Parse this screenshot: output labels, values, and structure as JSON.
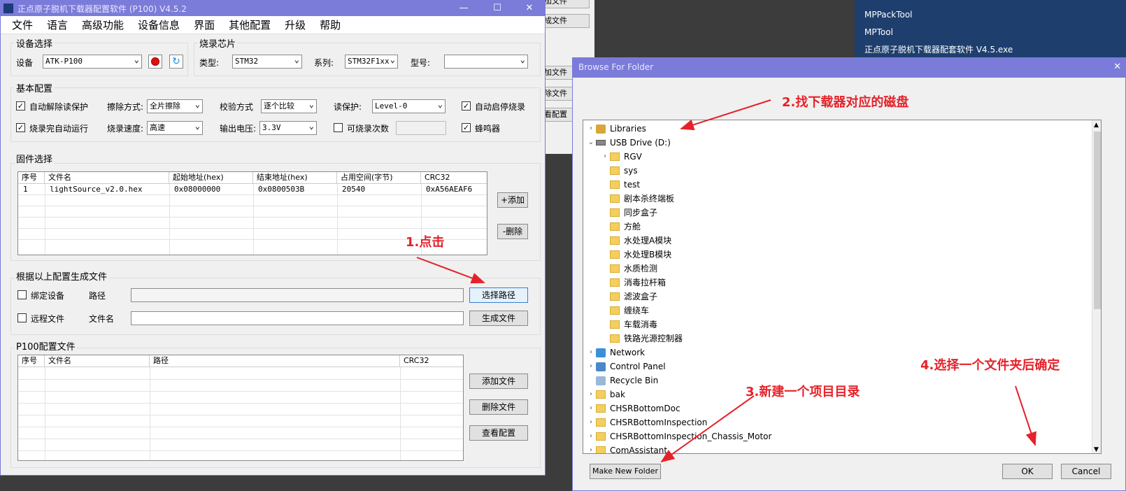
{
  "desktop": {
    "items": [
      {
        "label": "MPPackTool",
        "color": "#d89a2b"
      },
      {
        "label": "MPTool",
        "color": "#3a6fc4"
      },
      {
        "label": "正点原子脱机下载器配套软件 V4.5.exe",
        "color": "#2a4e8c"
      }
    ]
  },
  "behind_window": {
    "buttons": [
      "加文件",
      "成文件",
      "加文件",
      "除文件",
      "看配置"
    ]
  },
  "main_window": {
    "title": "正点原子脱机下载器配置软件 (P100)  V4.5.2",
    "controls": {
      "minimize": "—",
      "maximize": "☐",
      "close": "✕"
    },
    "menu": [
      "文件",
      "语言",
      "高级功能",
      "设备信息",
      "界面",
      "其他配置",
      "升级",
      "帮助"
    ],
    "device_group": {
      "title": "设备选择",
      "device_label": "设备",
      "device_value": "ATK-P100"
    },
    "chip_group": {
      "title": "烧录芯片",
      "type_label": "类型:",
      "type_value": "STM32",
      "series_label": "系列:",
      "series_value": "STM32F1xx",
      "model_label": "型号:",
      "model_value": ""
    },
    "basic_group": {
      "title": "基本配置",
      "auto_unprotect": "自动解除读保护",
      "erase_label": "擦除方式:",
      "erase_value": "全片擦除",
      "verify_label": "校验方式",
      "verify_value": "逐个比较",
      "readprot_label": "读保护:",
      "readprot_value": "Level-0",
      "auto_start": "自动启停烧录",
      "auto_run": "烧录完自动运行",
      "speed_label": "烧录速度:",
      "speed_value": "高速",
      "voltage_label": "输出电压:",
      "voltage_value": "3.3V",
      "count_label": "可烧录次数",
      "buzzer": "蜂鸣器"
    },
    "firmware_group": {
      "title": "固件选择",
      "headers": [
        "序号",
        "文件名",
        "起始地址(hex)",
        "结束地址(hex)",
        "占用空间(字节)",
        "CRC32"
      ],
      "rows": [
        [
          "1",
          "lightSource_v2.0.hex",
          "0x08000000",
          "0x0800503B",
          "20540",
          "0xA56AEAF6"
        ]
      ],
      "add_button": "+添加",
      "delete_button": "-删除"
    },
    "generate_group": {
      "title": "根据以上配置生成文件",
      "bind_device": "绑定设备",
      "path_label": "路径",
      "select_path_button": "选择路径",
      "remote_file": "远程文件",
      "filename_label": "文件名",
      "generate_button": "生成文件"
    },
    "p100_group": {
      "title": "P100配置文件",
      "headers": [
        "序号",
        "文件名",
        "路径",
        "CRC32"
      ],
      "add_file_button": "添加文件",
      "delete_file_button": "删除文件",
      "view_config_button": "查看配置"
    }
  },
  "dialog": {
    "title": "Browse For Folder",
    "close": "✕",
    "tree": [
      {
        "label": "Libraries",
        "indent": 0,
        "icon": "libraries",
        "expander": ">"
      },
      {
        "label": "USB Drive (D:)",
        "indent": 0,
        "icon": "drive",
        "expander": "v"
      },
      {
        "label": "RGV",
        "indent": 1,
        "icon": "folder",
        "expander": ">"
      },
      {
        "label": "sys",
        "indent": 1,
        "icon": "folder",
        "expander": ""
      },
      {
        "label": "test",
        "indent": 1,
        "icon": "folder",
        "expander": ""
      },
      {
        "label": "剧本杀终端板",
        "indent": 1,
        "icon": "folder",
        "expander": ""
      },
      {
        "label": "同步盒子",
        "indent": 1,
        "icon": "folder",
        "expander": ""
      },
      {
        "label": "方舱",
        "indent": 1,
        "icon": "folder",
        "expander": ""
      },
      {
        "label": "水处理A模块",
        "indent": 1,
        "icon": "folder",
        "expander": ""
      },
      {
        "label": "水处理B模块",
        "indent": 1,
        "icon": "folder",
        "expander": ""
      },
      {
        "label": "水质检测",
        "indent": 1,
        "icon": "folder",
        "expander": ""
      },
      {
        "label": "消毒拉杆箱",
        "indent": 1,
        "icon": "folder",
        "expander": ""
      },
      {
        "label": "滤波盒子",
        "indent": 1,
        "icon": "folder",
        "expander": ""
      },
      {
        "label": "缠绕车",
        "indent": 1,
        "icon": "folder",
        "expander": ""
      },
      {
        "label": "车载消毒",
        "indent": 1,
        "icon": "folder",
        "expander": ""
      },
      {
        "label": "铁路光源控制器",
        "indent": 1,
        "icon": "folder",
        "expander": ""
      },
      {
        "label": "Network",
        "indent": 0,
        "icon": "network",
        "expander": ">"
      },
      {
        "label": "Control Panel",
        "indent": 0,
        "icon": "control-panel",
        "expander": ">"
      },
      {
        "label": "Recycle Bin",
        "indent": 0,
        "icon": "recycle-bin",
        "expander": ""
      },
      {
        "label": "bak",
        "indent": 0,
        "icon": "folder",
        "expander": ">"
      },
      {
        "label": "CHSRBottomDoc",
        "indent": 0,
        "icon": "folder",
        "expander": ">"
      },
      {
        "label": "CHSRBottomInspection",
        "indent": 0,
        "icon": "folder",
        "expander": ">"
      },
      {
        "label": "CHSRBottomInspection_Chassis_Motor",
        "indent": 0,
        "icon": "folder",
        "expander": ">"
      },
      {
        "label": "ComAssistant",
        "indent": 0,
        "icon": "folder",
        "expander": ">"
      }
    ],
    "make_new_folder_button": "Make New Folder",
    "ok_button": "OK",
    "cancel_button": "Cancel"
  },
  "annotations": {
    "step1": "1.点击",
    "step2": "2.找下载器对应的磁盘",
    "step3": "3.新建一个项目目录",
    "step4": "4.选择一个文件夹后确定",
    "color": "#e5222a"
  }
}
